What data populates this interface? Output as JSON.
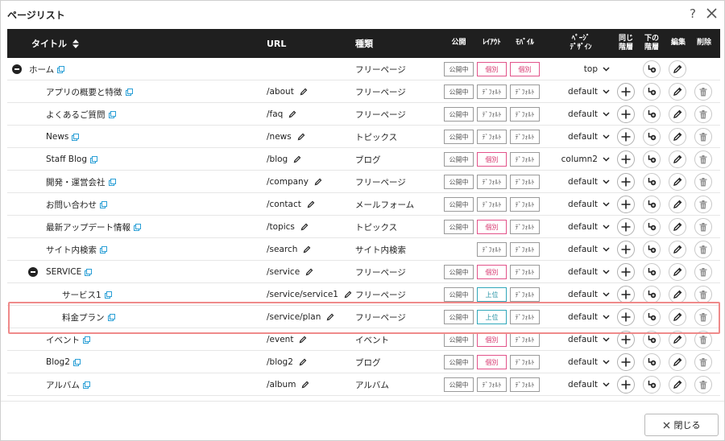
{
  "dialog": {
    "title": "ページリスト",
    "help_symbol": "?",
    "close_button_label": "閉じる"
  },
  "header": {
    "title": "タイトル",
    "url": "URL",
    "kind": "種類",
    "public": "公開",
    "layout": "ﾚｲｱｳﾄ",
    "mobile": "ﾓﾊﾞｲﾙ",
    "design_line1": "ﾍﾟｰｼﾞ",
    "design_line2": "ﾃﾞｻﾞｲﾝ",
    "same_line1": "同じ",
    "same_line2": "階層",
    "lower_line1": "下の",
    "lower_line2": "階層",
    "edit": "編集",
    "delete": "削除"
  },
  "colors": {
    "header_bg": "#1f1f1f",
    "pink_tag": "#e2538a",
    "teal_tag": "#31a7ba",
    "highlight": "#ef8a8a"
  },
  "rows": [
    {
      "title": "ホーム",
      "collapse": true,
      "url": "",
      "kind": "フリーページ",
      "public": "公開中",
      "layout": "個別",
      "layout_style": "pink",
      "mobile": "個別",
      "mobile_style": "pink",
      "design": "top",
      "add_same": false,
      "delete": false
    },
    {
      "title": "アプリの概要と特徴",
      "url": "/about",
      "kind": "フリーページ",
      "public": "公開中",
      "layout": "ﾃﾞﾌｫﾙﾄ",
      "layout_style": "gray",
      "mobile": "ﾃﾞﾌｫﾙﾄ",
      "mobile_style": "gray",
      "design": "default",
      "add_same": true,
      "delete": true
    },
    {
      "title": "よくあるご質問",
      "url": "/faq",
      "kind": "フリーページ",
      "public": "公開中",
      "layout": "ﾃﾞﾌｫﾙﾄ",
      "layout_style": "gray",
      "mobile": "ﾃﾞﾌｫﾙﾄ",
      "mobile_style": "gray",
      "design": "default",
      "add_same": true,
      "delete": true
    },
    {
      "title": "News",
      "url": "/news",
      "kind": "トピックス",
      "public": "公開中",
      "layout": "ﾃﾞﾌｫﾙﾄ",
      "layout_style": "gray",
      "mobile": "ﾃﾞﾌｫﾙﾄ",
      "mobile_style": "gray",
      "design": "default",
      "add_same": true,
      "delete": true
    },
    {
      "title": "Staff Blog",
      "url": "/blog",
      "kind": "ブログ",
      "public": "公開中",
      "layout": "個別",
      "layout_style": "pink",
      "mobile": "ﾃﾞﾌｫﾙﾄ",
      "mobile_style": "gray",
      "design": "column2",
      "add_same": true,
      "delete": true
    },
    {
      "title": "開発・運営会社",
      "url": "/company",
      "kind": "フリーページ",
      "public": "公開中",
      "layout": "ﾃﾞﾌｫﾙﾄ",
      "layout_style": "gray",
      "mobile": "ﾃﾞﾌｫﾙﾄ",
      "mobile_style": "gray",
      "design": "default",
      "add_same": true,
      "delete": true
    },
    {
      "title": "お問い合わせ",
      "url": "/contact",
      "kind": "メールフォーム",
      "public": "公開中",
      "layout": "ﾃﾞﾌｫﾙﾄ",
      "layout_style": "gray",
      "mobile": "ﾃﾞﾌｫﾙﾄ",
      "mobile_style": "gray",
      "design": "default",
      "add_same": true,
      "delete": true
    },
    {
      "title": "最新アップデート情報",
      "url": "/topics",
      "kind": "トピックス",
      "public": "公開中",
      "layout": "個別",
      "layout_style": "pink",
      "mobile": "ﾃﾞﾌｫﾙﾄ",
      "mobile_style": "gray",
      "design": "default",
      "add_same": true,
      "delete": true
    },
    {
      "title": "サイト内検索",
      "url": "/search",
      "kind": "サイト内検索",
      "public": "",
      "layout": "ﾃﾞﾌｫﾙﾄ",
      "layout_style": "gray",
      "mobile": "ﾃﾞﾌｫﾙﾄ",
      "mobile_style": "gray",
      "design": "default",
      "add_same": true,
      "delete": true,
      "no_edit": true
    },
    {
      "title": "SERVICE",
      "collapse": true,
      "url": "/service",
      "kind": "フリーページ",
      "public": "公開中",
      "layout": "個別",
      "layout_style": "pink",
      "mobile": "ﾃﾞﾌｫﾙﾄ",
      "mobile_style": "gray",
      "design": "default",
      "add_same": true,
      "delete": true
    },
    {
      "title": "サービス1",
      "url": "/service/service1",
      "kind": "フリーページ",
      "public": "公開中",
      "layout": "上位",
      "layout_style": "teal",
      "mobile": "ﾃﾞﾌｫﾙﾄ",
      "mobile_style": "gray",
      "design": "default",
      "add_same": true,
      "delete": true
    },
    {
      "title": "料金プラン",
      "url": "/service/plan",
      "kind": "フリーページ",
      "public": "公開中",
      "layout": "上位",
      "layout_style": "teal",
      "mobile": "ﾃﾞﾌｫﾙﾄ",
      "mobile_style": "gray",
      "design": "default",
      "add_same": true,
      "delete": true
    },
    {
      "title": "イベント",
      "url": "/event",
      "kind": "イベント",
      "public": "公開中",
      "layout": "個別",
      "layout_style": "pink",
      "mobile": "ﾃﾞﾌｫﾙﾄ",
      "mobile_style": "gray",
      "design": "default",
      "add_same": true,
      "delete": true
    },
    {
      "title": "Blog2",
      "url": "/blog2",
      "kind": "ブログ",
      "public": "公開中",
      "layout": "個別",
      "layout_style": "pink",
      "mobile": "ﾃﾞﾌｫﾙﾄ",
      "mobile_style": "gray",
      "design": "default",
      "add_same": true,
      "delete": true
    },
    {
      "title": "アルバム",
      "url": "/album",
      "kind": "アルバム",
      "public": "公開中",
      "layout": "ﾃﾞﾌｫﾙﾄ",
      "layout_style": "gray",
      "mobile": "ﾃﾞﾌｫﾙﾄ",
      "mobile_style": "gray",
      "design": "default",
      "add_same": true,
      "delete": true
    }
  ]
}
